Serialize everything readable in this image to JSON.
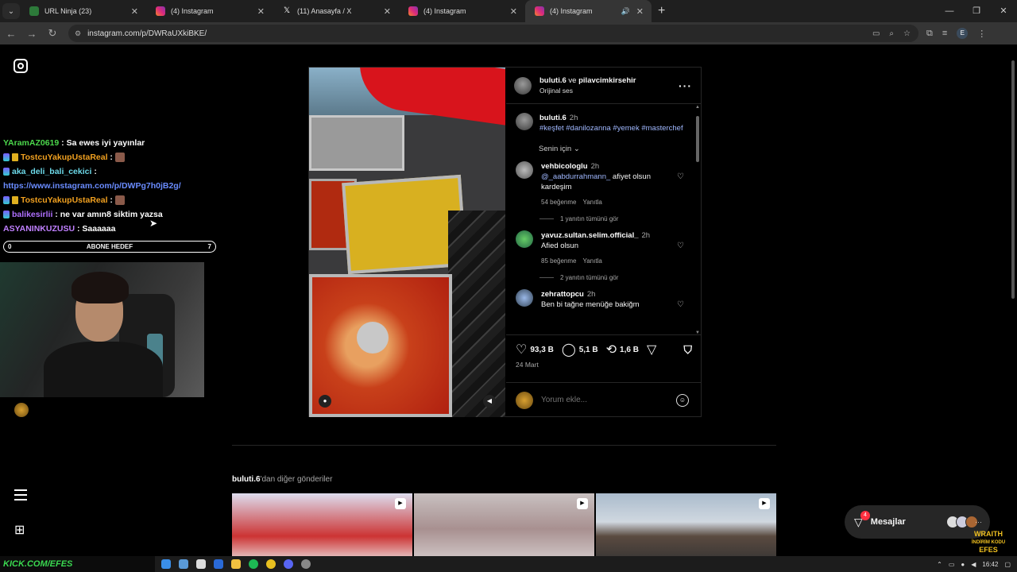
{
  "browser": {
    "tabs": [
      {
        "title": "URL Ninja (23)",
        "favicon": "url-ninja-icon",
        "active": false
      },
      {
        "title": "(4) Instagram",
        "favicon": "instagram-icon",
        "active": false
      },
      {
        "title": "(11) Anasayfa / X",
        "favicon": "x-icon",
        "active": false
      },
      {
        "title": "(4) Instagram",
        "favicon": "instagram-icon",
        "active": false
      },
      {
        "title": "(4) Instagram",
        "favicon": "instagram-icon",
        "active": true
      }
    ],
    "url": "instagram.com/p/DWRaUXkiBKE/",
    "profile_initial": "E"
  },
  "stream_chat": [
    {
      "user": "YAramAZ0619",
      "user_color": "#4cd84c",
      "msg": "Sa ewes iyi yayınlar",
      "badges": []
    },
    {
      "user": "TostcuYakupUstaReal",
      "user_color": "#f0a020",
      "msg": "",
      "badges": [
        "sub",
        "gift"
      ],
      "emote": true
    },
    {
      "user": "aka_deli_bali_cekici",
      "user_color": "#6cd8e8",
      "msg": "",
      "badges": [
        "sub"
      ]
    },
    {
      "user": "",
      "user_color": "#6a8cff",
      "msg": "https://www.instagram.com/p/DWPg7h0jB2g/",
      "badges": [],
      "is_link": true
    },
    {
      "user": "TostcuYakupUstaReal",
      "user_color": "#f0a020",
      "msg": "",
      "badges": [
        "sub",
        "gift"
      ],
      "emote": true
    },
    {
      "user": "balikesirlii",
      "user_color": "#b070ff",
      "msg": "ne var amın8 siktim yazsa",
      "badges": [
        "sub"
      ]
    },
    {
      "user": "ASYANINKUZUSU",
      "user_color": "#c080ff",
      "msg": "Saaaaaa",
      "badges": []
    }
  ],
  "goal_bar": {
    "left": "0",
    "label": "ABONE HEDEF",
    "right": "7"
  },
  "post": {
    "header": {
      "author": "buluti.6",
      "conj": "ve",
      "coauthor": "pilavcimkirsehir",
      "audio": "Orijinal ses"
    },
    "caption": {
      "user": "buluti.6",
      "time": "2h",
      "tags": "#keşfet #danilozanna #yemek #masterchef"
    },
    "for_you": "Senin için",
    "comments": [
      {
        "user": "vehbicologlu",
        "time": "2h",
        "mention": "@_aabdurrahmann_",
        "text": " afiyet olsun kardeşim",
        "likes": "54 beğenme",
        "reply": "Yanıtla",
        "view_replies": "1 yanıtın tümünü gör"
      },
      {
        "user": "yavuz.sultan.selim.official_",
        "time": "2h",
        "mention": "",
        "text": "Afied olsun",
        "likes": "85 beğenme",
        "reply": "Yanıtla",
        "view_replies": "2 yanıtın tümünü gör"
      },
      {
        "user": "zehrattopcu",
        "time": "2h",
        "mention": "",
        "text": "Ben bi tağne menüğe bakiğm",
        "likes": "",
        "reply": "",
        "view_replies": ""
      }
    ],
    "stats": {
      "likes": "93,3 B",
      "comments": "5,1 B",
      "reposts": "1,6 B"
    },
    "date": "24 Mart",
    "comment_placeholder": "Yorum ekle..."
  },
  "more_posts": {
    "user": "buluti.6",
    "suffix": "'dan diğer gönderiler"
  },
  "messages": {
    "label": "Mesajlar",
    "count": "4"
  },
  "overlay_brand": {
    "line1": "WRAITH",
    "line2": "İNDİRİM KODU",
    "line3": "EFES"
  },
  "taskbar": {
    "banner": "KICK.COM/EFES",
    "time": "16:42"
  },
  "colors": {
    "background": "#000000",
    "accent_link": "#a0b8ff",
    "notification": "#ff3040"
  }
}
